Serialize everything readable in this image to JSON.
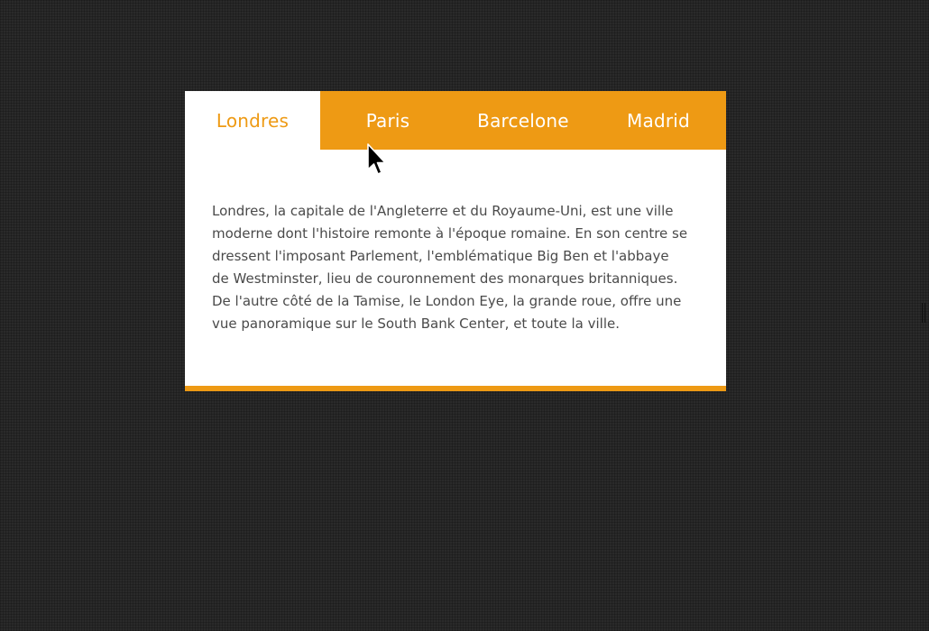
{
  "tabs": [
    {
      "label": "Londres",
      "active": true
    },
    {
      "label": "Paris",
      "active": false
    },
    {
      "label": "Barcelone",
      "active": false
    },
    {
      "label": "Madrid",
      "active": false
    }
  ],
  "content": {
    "text": "Londres, la capitale de l'Angleterre et du Royaume-Uni, est une ville moderne dont l'histoire remonte à l'époque romaine. En son centre se dressent l'imposant Parlement, l'emblématique Big Ben et l'abbaye de Westminster, lieu de couronnement des monarques britanniques. De l'autre côté de la Tamise, le London Eye, la grande roue, offre une vue panoramique sur le South Bank Center, et toute la ville."
  },
  "colors": {
    "accent": "#ee9a14",
    "background": "#2a2a2a",
    "panel": "#ffffff",
    "text": "#4a4a4a"
  },
  "icons": {
    "cursor": "mouse-pointer-icon",
    "resize": "resize-handle-icon"
  }
}
